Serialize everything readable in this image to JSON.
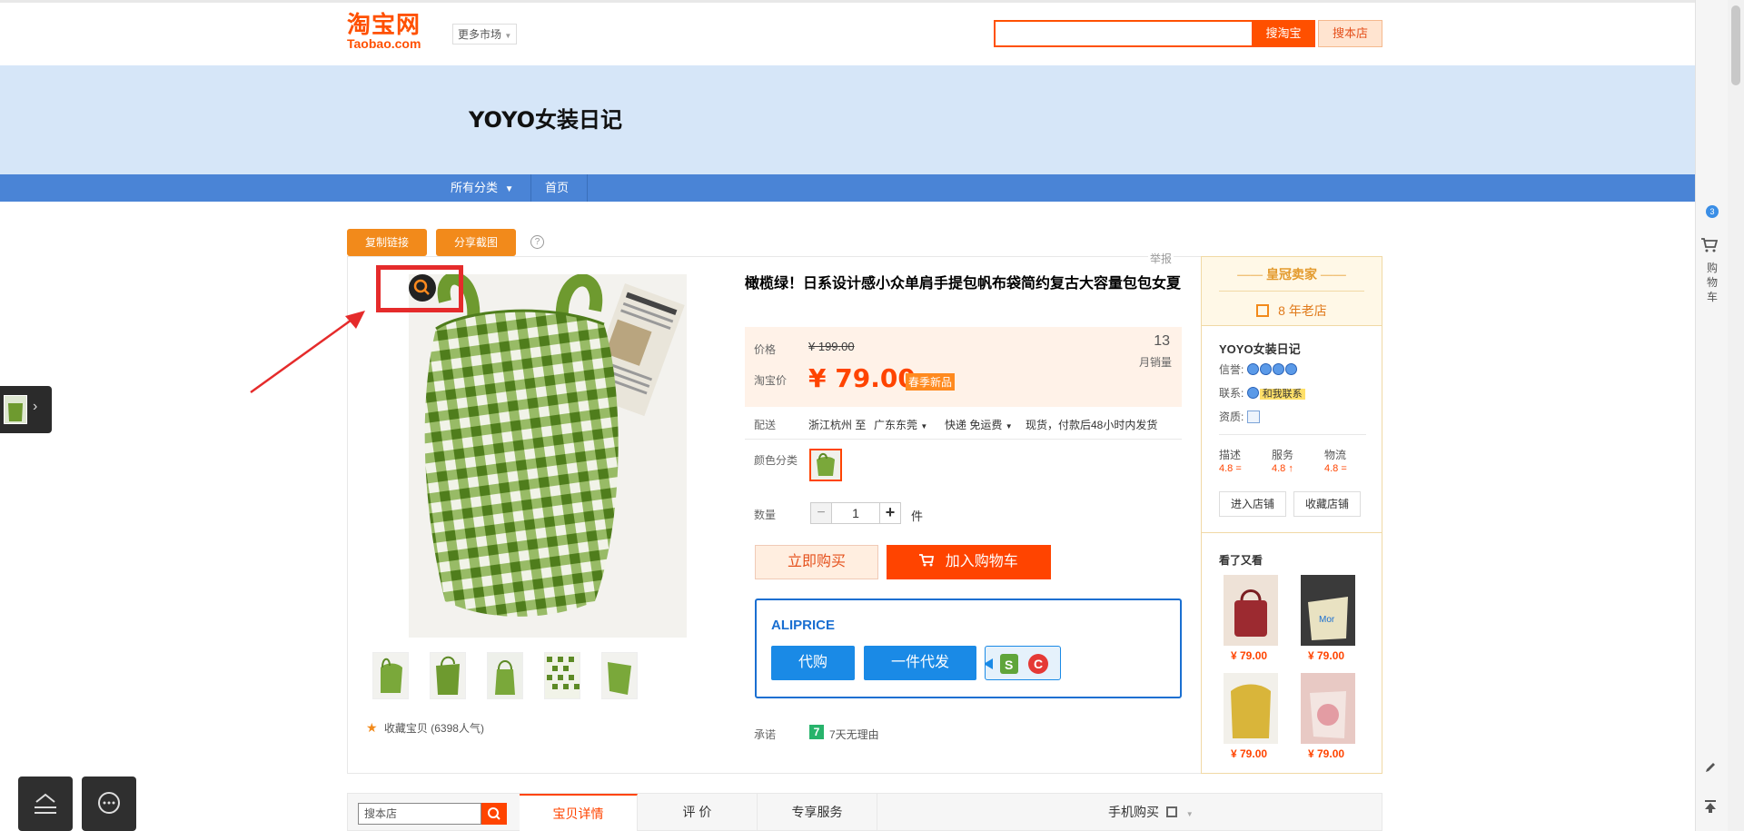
{
  "header": {
    "logo_cn": "淘宝网",
    "logo_en": "Taobao.com",
    "market_label": "更多市场",
    "search_value": "",
    "search_taobao_button": "搜淘宝",
    "search_shop_button": "搜本店"
  },
  "shop": {
    "name": "YOYO女装日记",
    "nav": [
      "所有分类",
      "首页"
    ]
  },
  "toolbar": {
    "copy_link": "复制链接",
    "share_screenshot": "分享截图",
    "help": "?",
    "report": "举报"
  },
  "gallery": {
    "thumbnail_count": 5,
    "favorite_label": "收藏宝贝",
    "favorite_count": "(6398人气)"
  },
  "product": {
    "title": "橄榄绿！日系设计感小众单肩手提包帆布袋简约复古大容量包包女夏",
    "price_label": "价格",
    "original_price": "¥ 199.00",
    "taobao_price_label": "淘宝价",
    "price": "¥ 79.00",
    "price_tag": "春季新品",
    "monthly_sales_count": "13",
    "monthly_sales_label": "月销量",
    "delivery_label": "配送",
    "delivery_from": "浙江杭州 至",
    "delivery_to": "广东东莞",
    "shipping": "快递 免运费",
    "stock_note": "现货，付款后48小时内发货",
    "color_label": "颜色分类",
    "quantity_label": "数量",
    "quantity_value": "1",
    "quantity_unit": "件",
    "buy_now": "立即购买",
    "add_to_cart": "加入购物车",
    "promise_label": "承诺",
    "promise_badge": "7",
    "promise_text": "7天无理由"
  },
  "aliprice": {
    "title": "ALIPRICE",
    "buy_for_me": "代购",
    "dropship": "一件代发"
  },
  "seller": {
    "crown": "皇冠卖家",
    "years": "8 年老店",
    "name": "YOYO女装日记",
    "credit_label": "信誉:",
    "contact_label": "联系:",
    "contact_button": "和我联系",
    "qualification_label": "资质:",
    "scores": [
      {
        "label": "描述",
        "value": "4.8",
        "trend": "="
      },
      {
        "label": "服务",
        "value": "4.8",
        "trend": "↑"
      },
      {
        "label": "物流",
        "value": "4.8",
        "trend": "="
      }
    ],
    "enter_shop": "进入店铺",
    "favorite_shop": "收藏店铺",
    "seen_title": "看了又看",
    "seen_items": [
      {
        "price": "¥ 79.00",
        "color": "#9c2a30"
      },
      {
        "price": "¥ 79.00",
        "color": "#e9e2c2"
      },
      {
        "price": "¥ 79.00",
        "color": "#d9b53a"
      },
      {
        "price": "¥ 79.00",
        "color": "#e8c9c4"
      }
    ]
  },
  "tabs": {
    "shop_search_placeholder": "搜本店",
    "items": [
      "宝贝详情",
      "评 价",
      "专享服务"
    ],
    "mobile_buy": "手机购买"
  },
  "rightbar": {
    "badge": "3",
    "cart": [
      "购",
      "物",
      "车"
    ]
  },
  "colors": {
    "brand_orange": "#ff5000",
    "price_red": "#ff4400",
    "nav_blue": "#4a84d6",
    "aliprice_blue": "#1a6fd1",
    "product_green": "#6e9a2f"
  }
}
